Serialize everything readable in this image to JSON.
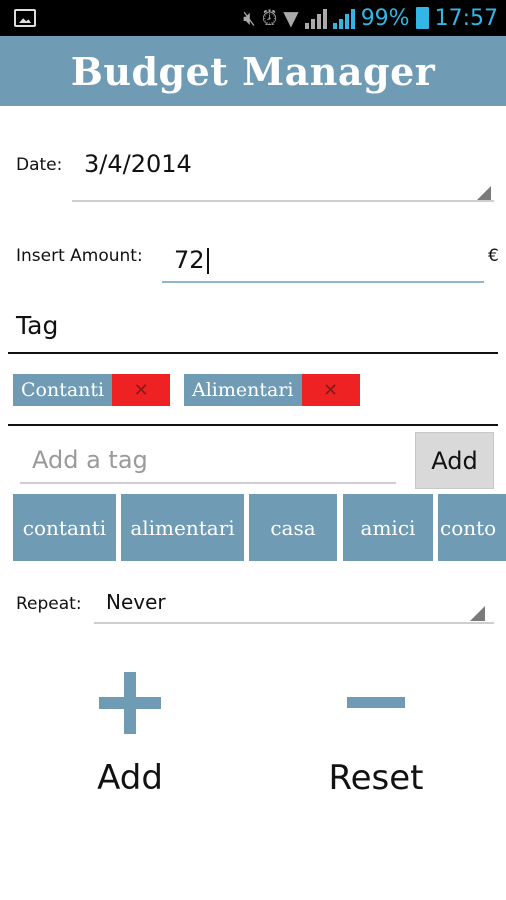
{
  "status_bar": {
    "battery": "99%",
    "time": "17:57",
    "icons": [
      "gallery-icon",
      "mute-icon",
      "alarm-icon",
      "wifi-icon",
      "signal-icon",
      "signal-icon",
      "battery-icon"
    ]
  },
  "header": {
    "title": "Budget Manager"
  },
  "form": {
    "date_label": "Date:",
    "date_value": "3/4/2014",
    "amount_label": "Insert Amount:",
    "amount_value": "72",
    "currency": "€",
    "tag_section_title": "Tag",
    "selected_tags": [
      {
        "label": "Contanti",
        "remove_icon": "close-icon"
      },
      {
        "label": "Alimentari",
        "remove_icon": "close-icon"
      }
    ],
    "add_tag_placeholder": "Add a tag",
    "add_tag_button": "Add",
    "suggested_tags": [
      "contanti",
      "alimentari",
      "casa",
      "amici",
      "conto"
    ],
    "repeat_label": "Repeat:",
    "repeat_value": "Never"
  },
  "actions": {
    "add_label": "Add",
    "reset_label": "Reset"
  },
  "colors": {
    "accent": "#6f9bb5",
    "remove": "#ee2222",
    "status_blue": "#33b5e5"
  }
}
